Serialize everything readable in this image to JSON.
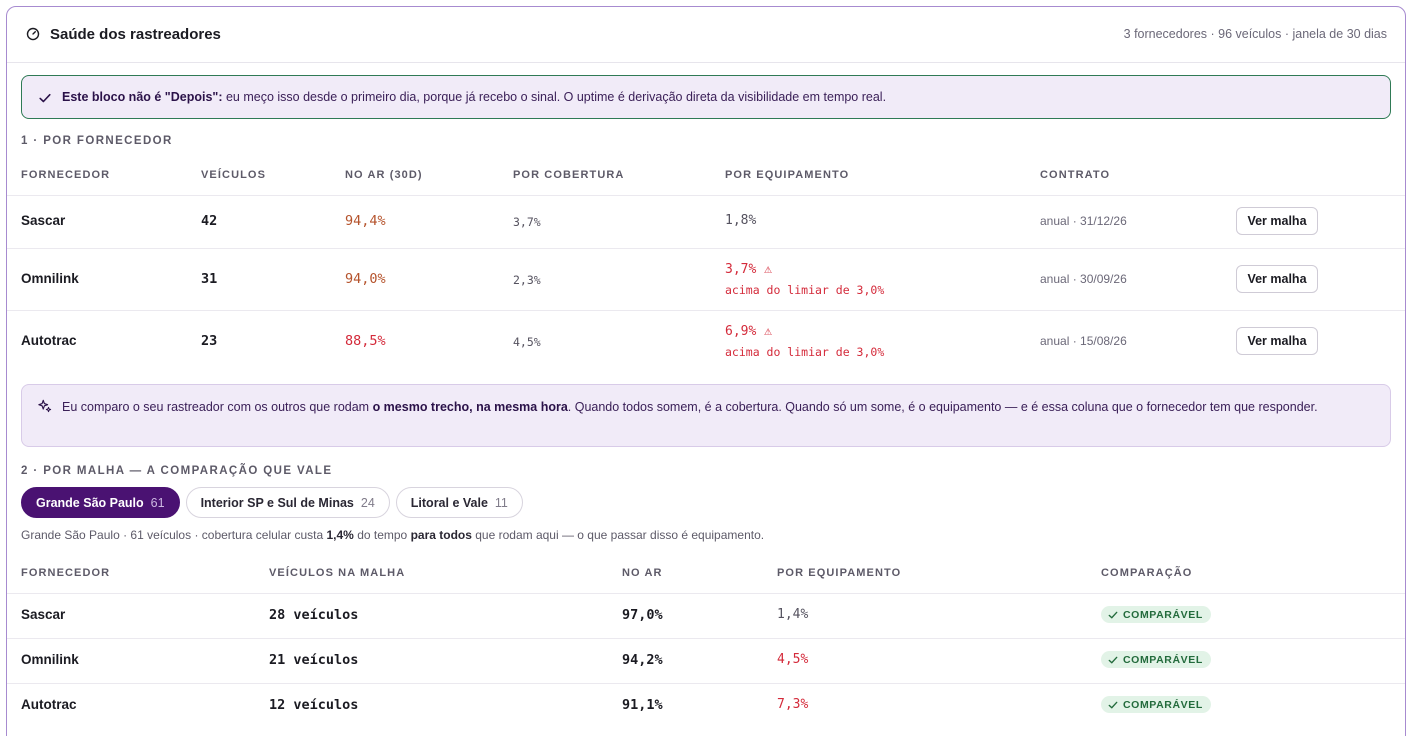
{
  "header": {
    "title": "Saúde dos rastreadores",
    "meta": "3 fornecedores · 96 veículos · janela de 30 dias",
    "icon": "gauge-icon"
  },
  "notice": {
    "icon": "check-icon",
    "strong": "Este bloco não é \"Depois\":",
    "text": " eu meço isso desde o primeiro dia, porque já recebo o sinal. O uptime é derivação direta da visibilidade em tempo real."
  },
  "section1": {
    "title": "1 · POR FORNECEDOR",
    "columns": [
      "FORNECEDOR",
      "VEÍCULOS",
      "NO AR (30D)",
      "POR COBERTURA",
      "POR EQUIPAMENTO",
      "CONTRATO"
    ],
    "rows": [
      {
        "provider": "Sascar",
        "vehicles": "42",
        "uptime": "94,4%",
        "coverage": "3,7%",
        "equipment": "1,8%",
        "warn": false,
        "warn_note": "",
        "contract": "anual · 31/12/26",
        "action": "Ver malha"
      },
      {
        "provider": "Omnilink",
        "vehicles": "31",
        "uptime": "94,0%",
        "coverage": "2,3%",
        "equipment": "3,7% ⚠",
        "warn": true,
        "warn_note": "acima do limiar de 3,0%",
        "contract": "anual · 30/09/26",
        "action": "Ver malha"
      },
      {
        "provider": "Autotrac",
        "vehicles": "23",
        "uptime": "88,5%",
        "coverage": "4,5%",
        "equipment": "6,9% ⚠",
        "warn": true,
        "warn_note": "acima do limiar de 3,0%",
        "contract": "anual · 15/08/26",
        "action": "Ver malha"
      }
    ]
  },
  "info": {
    "icon": "sparkles-icon",
    "pre": "Eu comparo o seu rastreador com os outros que rodam ",
    "strong": "o mesmo trecho, na mesma hora",
    "post": ". Quando todos somem, é a cobertura. Quando só um some, é o equipamento — e é essa coluna que o fornecedor tem que responder."
  },
  "section2": {
    "title": "2 · POR MALHA — A COMPARAÇÃO QUE VALE",
    "tabs": [
      {
        "label": "Grande São Paulo",
        "count": "61",
        "active": true
      },
      {
        "label": "Interior SP e Sul de Minas",
        "count": "24",
        "active": false
      },
      {
        "label": "Litoral e Vale",
        "count": "11",
        "active": false
      }
    ],
    "caption_pre": "Grande São Paulo · 61 veículos · cobertura celular custa ",
    "caption_strong1": "1,4%",
    "caption_mid": " do tempo ",
    "caption_strong2": "para todos",
    "caption_post": " que rodam aqui — o que passar disso é equipamento.",
    "columns": [
      "FORNECEDOR",
      "VEÍCULOS NA MALHA",
      "NO AR",
      "POR EQUIPAMENTO",
      "COMPARAÇÃO"
    ],
    "rows": [
      {
        "provider": "Sascar",
        "vehicles": "28 veículos",
        "uptime": "97,0%",
        "equipment": "1,4%",
        "equip_red": false,
        "badge": "COMPARÁVEL"
      },
      {
        "provider": "Omnilink",
        "vehicles": "21 veículos",
        "uptime": "94,2%",
        "equipment": "4,5%",
        "equip_red": true,
        "badge": "COMPARÁVEL"
      },
      {
        "provider": "Autotrac",
        "vehicles": "12 veículos",
        "uptime": "91,1%",
        "equipment": "7,3%",
        "equip_red": true,
        "badge": "COMPARÁVEL"
      }
    ]
  },
  "colors": {
    "accent": "#4a1272",
    "warn": "#d42a3a",
    "uptime_mid": "#b5532c",
    "ok": "#236b3c",
    "ok_bg": "#e2f3e7"
  }
}
